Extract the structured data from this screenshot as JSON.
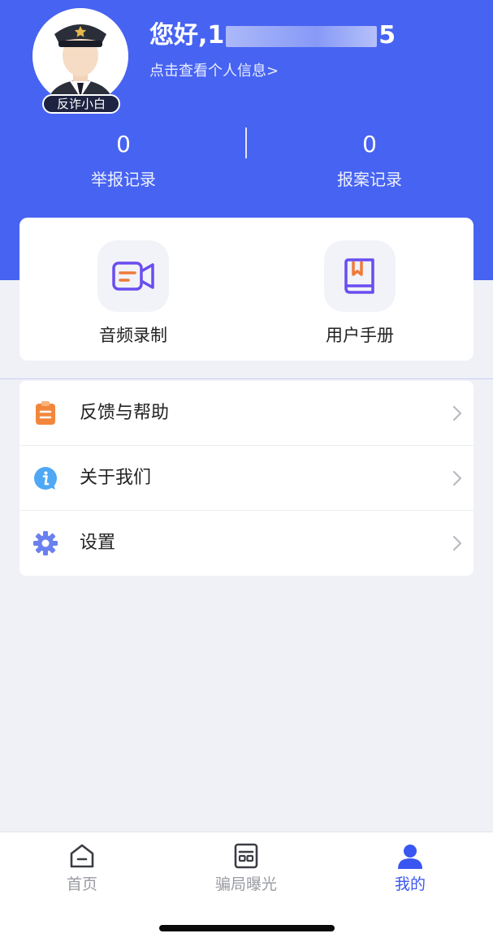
{
  "header": {
    "avatar_badge": "反诈小白",
    "greeting_prefix": "您好,1",
    "greeting_suffix": "5",
    "profile_link": "点击查看个人信息>"
  },
  "stats": [
    {
      "value": "0",
      "label": "举报记录"
    },
    {
      "value": "0",
      "label": "报案记录"
    }
  ],
  "quick_actions": [
    {
      "label": "音频录制",
      "icon": "video-record-icon"
    },
    {
      "label": "用户手册",
      "icon": "manual-book-icon"
    }
  ],
  "menu": [
    {
      "label": "反馈与帮助",
      "icon": "clipboard-icon"
    },
    {
      "label": "关于我们",
      "icon": "info-icon"
    },
    {
      "label": "设置",
      "icon": "gear-icon"
    }
  ],
  "tabbar": [
    {
      "label": "首页",
      "icon": "home-icon"
    },
    {
      "label": "骗局曝光",
      "icon": "exposure-icon"
    },
    {
      "label": "我的",
      "icon": "profile-icon",
      "active": true
    }
  ],
  "colors": {
    "brand_blue": "#4763f2",
    "active_tab": "#3a56f0",
    "page_bg": "#f0f1f6"
  }
}
